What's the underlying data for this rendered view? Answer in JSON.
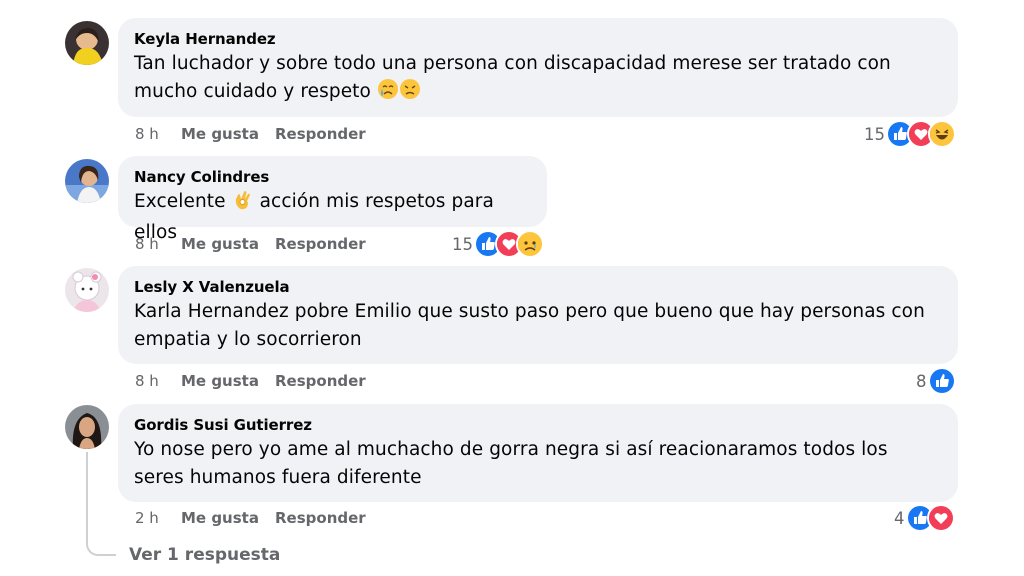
{
  "comments": [
    {
      "author": "Keyla Hernandez",
      "text": "Tan luchador y sobre todo una persona con discapacidad merese ser tratado con mucho cuidado y respeto",
      "emojis": [
        "crying-face-emoji",
        "sad-face-emoji"
      ],
      "time": "8 h",
      "like_label": "Me gusta",
      "reply_label": "Responder",
      "reaction_count": "15",
      "reactions": [
        "like-icon",
        "love-icon",
        "haha-icon"
      ]
    },
    {
      "author": "Nancy Colindres",
      "text_before": "Excelente",
      "text_after": "acción mis respetos para ellos",
      "emojis": [
        "ok-hand-emoji"
      ],
      "time": "8 h",
      "like_label": "Me gusta",
      "reply_label": "Responder",
      "reaction_count": "15",
      "reactions": [
        "like-icon",
        "love-icon",
        "sad-icon"
      ]
    },
    {
      "author": "Lesly X Valenzuela",
      "text": "Karla Hernandez pobre Emilio que susto paso pero que bueno que hay personas con empatia y lo socorrieron",
      "time": "8 h",
      "like_label": "Me gusta",
      "reply_label": "Responder",
      "reaction_count": "8",
      "reactions": [
        "like-icon"
      ]
    },
    {
      "author": "Gordis Susi Gutierrez",
      "text": "Yo nose pero yo ame al muchacho de gorra negra si así reacionaramos todos los seres humanos fuera diferente",
      "time": "2 h",
      "like_label": "Me gusta",
      "reply_label": "Responder",
      "reaction_count": "4",
      "reactions": [
        "like-icon",
        "love-icon"
      ]
    }
  ],
  "view_replies_label": "Ver 1 respuesta",
  "colors": {
    "bubble": "#f0f2f5",
    "secondary_text": "#65676b",
    "like_blue": "#1877f2",
    "love_red": "#f33e58",
    "emoji_yellow": "#fcc53c"
  }
}
